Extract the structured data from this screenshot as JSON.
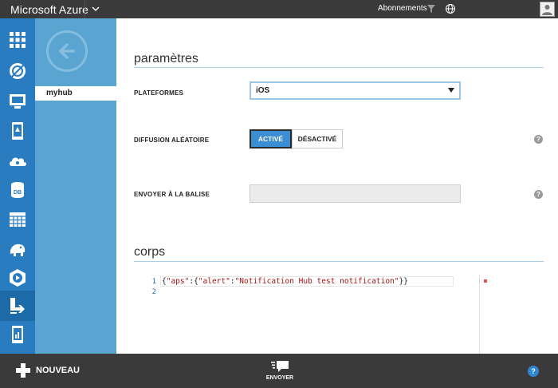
{
  "topbar": {
    "brand": "Microsoft Azure",
    "subscriptions_label": "Abonnements",
    "icons": [
      "chevron-down-icon",
      "filter-icon",
      "globe-icon",
      "avatar"
    ]
  },
  "rail": {
    "items": [
      {
        "name": "all-items-icon"
      },
      {
        "name": "websites-icon"
      },
      {
        "name": "virtual-machines-icon"
      },
      {
        "name": "mobile-services-icon"
      },
      {
        "name": "cloud-services-icon"
      },
      {
        "name": "sql-databases-icon"
      },
      {
        "name": "storage-icon"
      },
      {
        "name": "hdinsight-icon"
      },
      {
        "name": "media-services-icon"
      },
      {
        "name": "service-bus-icon"
      },
      {
        "name": "notification-hubs-icon"
      }
    ],
    "active_index": 9
  },
  "nav2": {
    "hub_name": "myhub"
  },
  "settings": {
    "section_title": "paramètres",
    "platforms_label": "PLATEFORMES",
    "platform_value": "iOS",
    "broadcast_label": "DIFFUSION ALÉATOIRE",
    "toggle_on": "ACTIVÉ",
    "toggle_off": "DÉSACTIVÉ",
    "toggle_state": "on",
    "tag_label": "ENVOYER À LA BALISE",
    "tag_value": "",
    "help_glyph": "?"
  },
  "body": {
    "section_title": "corps",
    "line_numbers": [
      "1",
      "2"
    ],
    "code_tokens": [
      "{",
      "\"aps\"",
      ":{",
      "\"alert\"",
      ":",
      "\"Notification Hub test notification\"",
      "}}"
    ]
  },
  "cmdbar": {
    "new_label": "NOUVEAU",
    "send_label": "ENVOYER",
    "help_glyph": "?"
  },
  "colors": {
    "topbar": "#3a3a3a",
    "rail": "#2a7cc0",
    "nav2": "#59a4d1",
    "accent": "#3b8dd4",
    "section_rule": "#a9cfe7"
  }
}
